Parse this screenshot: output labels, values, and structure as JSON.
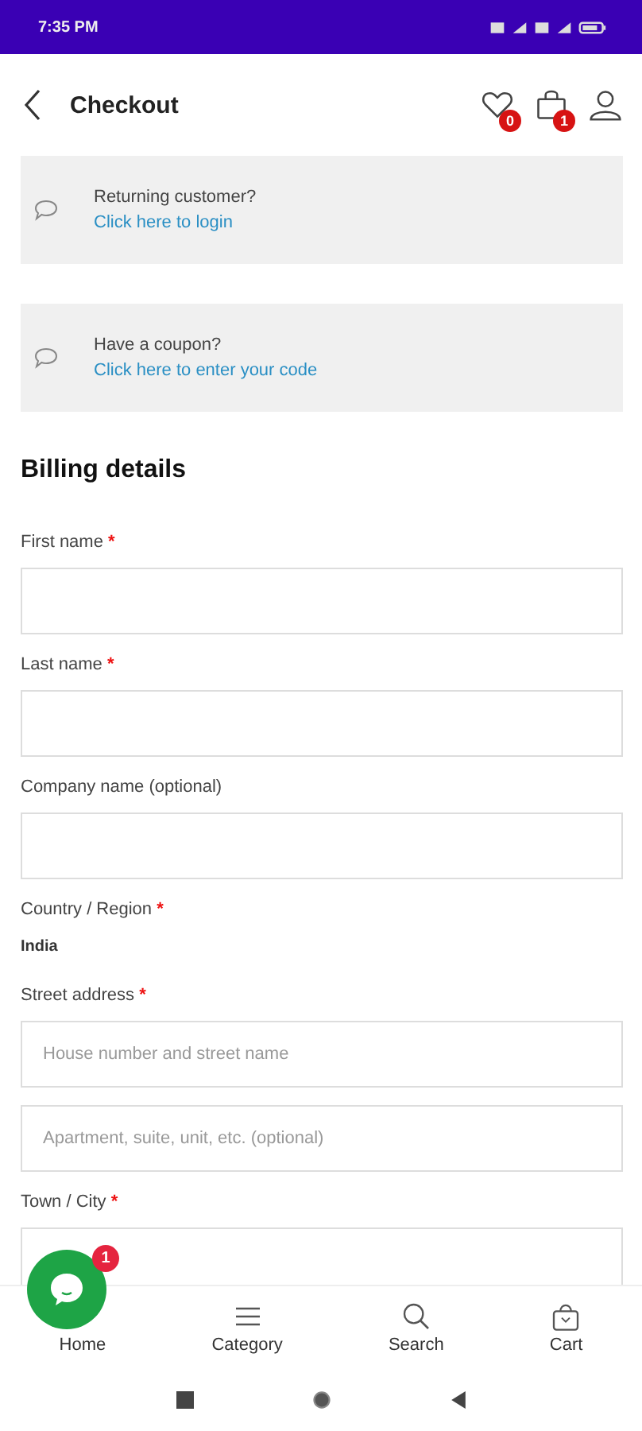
{
  "status_bar": {
    "time": "7:35 PM"
  },
  "header": {
    "title": "Checkout",
    "wishlist_count": "0",
    "cart_count": "1"
  },
  "notices": [
    {
      "text": "Returning customer?",
      "link": "Click here to login"
    },
    {
      "text": "Have a coupon?",
      "link": "Click here to enter your code"
    }
  ],
  "billing": {
    "heading": "Billing details",
    "fields": [
      {
        "kind": "input",
        "label": "First name",
        "required_mark": "*"
      },
      {
        "kind": "input",
        "label": "Last name",
        "required_mark": "*"
      },
      {
        "kind": "input",
        "label": "Company name (optional)"
      },
      {
        "kind": "static",
        "label": "Country / Region",
        "required_mark": "*",
        "value": "India"
      },
      {
        "kind": "input",
        "label": "Street address",
        "required_mark": "*",
        "placeholder": "House number and street name"
      },
      {
        "kind": "input",
        "placeholder": "Apartment, suite, unit, etc. (optional)"
      },
      {
        "kind": "input",
        "label": "Town / City",
        "required_mark": "*"
      }
    ]
  },
  "chat_button": {
    "badge": "1"
  },
  "bottom_nav": [
    {
      "kind": "home",
      "label": "Home"
    },
    {
      "kind": "category",
      "label": "Category"
    },
    {
      "kind": "search",
      "label": "Search"
    },
    {
      "kind": "cart",
      "label": "Cart"
    }
  ]
}
